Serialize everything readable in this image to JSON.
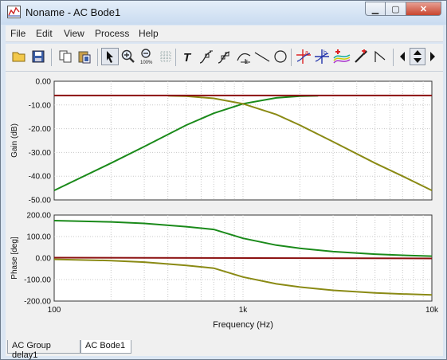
{
  "window": {
    "title": "Noname - AC Bode1"
  },
  "window_controls": {
    "minimize": "▁",
    "maximize": "▢",
    "close": "✕"
  },
  "menu": [
    "File",
    "Edit",
    "View",
    "Process",
    "Help"
  ],
  "toolbar_icons": [
    "open-icon",
    "save-icon",
    "copy-icon",
    "paste-icon",
    "pointer-icon",
    "zoom-in-icon",
    "zoom-100-icon",
    "grid-icon",
    "text-icon",
    "cursor-a-icon",
    "cursor-b-icon",
    "tangent-icon",
    "line-icon",
    "circle-icon",
    "marker-a-icon",
    "marker-b-icon",
    "add-curve-icon",
    "pick-color-icon",
    "poly-line-icon",
    "scroll-left-icon",
    "scroll-updown-icon",
    "scroll-right-icon"
  ],
  "tabs": [
    {
      "label": "AC Group delay1",
      "active": false
    },
    {
      "label": "AC Bode1",
      "active": true
    }
  ],
  "colors": {
    "green": "#1a8a1a",
    "olive": "#8a8a14",
    "darkred": "#8b1010"
  },
  "chart_data": [
    {
      "type": "line",
      "title": "",
      "xlabel": "",
      "ylabel": "Gain (dB)",
      "xscale": "log",
      "xlim": [
        100,
        10000
      ],
      "ylim": [
        -50,
        0
      ],
      "yticks": [
        "0.00",
        "-10.00",
        "-20.00",
        "-30.00",
        "-40.00",
        "-50.00"
      ],
      "ytick_values": [
        0,
        -10,
        -20,
        -30,
        -40,
        -50
      ],
      "grid": true,
      "series": [
        {
          "color": "#1a8a1a",
          "x": [
            100,
            200,
            300,
            500,
            700,
            1000,
            1500,
            2000,
            2500
          ],
          "y": [
            -46,
            -34.5,
            -27.5,
            -18.5,
            -13.5,
            -9.5,
            -7,
            -6.3,
            -6.1
          ]
        },
        {
          "color": "#8a8a14",
          "x": [
            400,
            500,
            700,
            1000,
            1500,
            2000,
            3000,
            5000,
            7000,
            10000
          ],
          "y": [
            -6.1,
            -6.3,
            -7.2,
            -9.5,
            -14,
            -18.5,
            -25.5,
            -34.5,
            -40,
            -46
          ]
        },
        {
          "color": "#8b1010",
          "x": [
            100,
            10000
          ],
          "y": [
            -6,
            -6
          ]
        }
      ]
    },
    {
      "type": "line",
      "title": "",
      "xlabel": "Frequency (Hz)",
      "ylabel": "Phase [deg]",
      "xscale": "log",
      "xlim": [
        100,
        10000
      ],
      "ylim": [
        -200,
        200
      ],
      "xticks": [
        "100",
        "1k",
        "10k"
      ],
      "xtick_values": [
        100,
        1000,
        10000
      ],
      "yticks": [
        "200.00",
        "100.00",
        "0.00",
        "-100.00",
        "-200.00"
      ],
      "ytick_values": [
        200,
        100,
        0,
        -100,
        -200
      ],
      "grid": true,
      "series": [
        {
          "color": "#1a8a1a",
          "x": [
            100,
            200,
            300,
            500,
            700,
            1000,
            1500,
            2000,
            3000,
            5000,
            7000,
            10000
          ],
          "y": [
            174,
            168,
            161,
            146,
            133,
            92,
            60,
            45,
            30,
            18,
            13,
            9
          ]
        },
        {
          "color": "#8a8a14",
          "x": [
            100,
            200,
            300,
            500,
            700,
            1000,
            1500,
            2000,
            3000,
            5000,
            7000,
            10000
          ],
          "y": [
            -6,
            -12,
            -19,
            -34,
            -47,
            -88,
            -120,
            -135,
            -150,
            -162,
            -167,
            -171
          ]
        },
        {
          "color": "#8b1010",
          "x": [
            100,
            10000
          ],
          "y": [
            2,
            -2
          ]
        }
      ]
    }
  ]
}
